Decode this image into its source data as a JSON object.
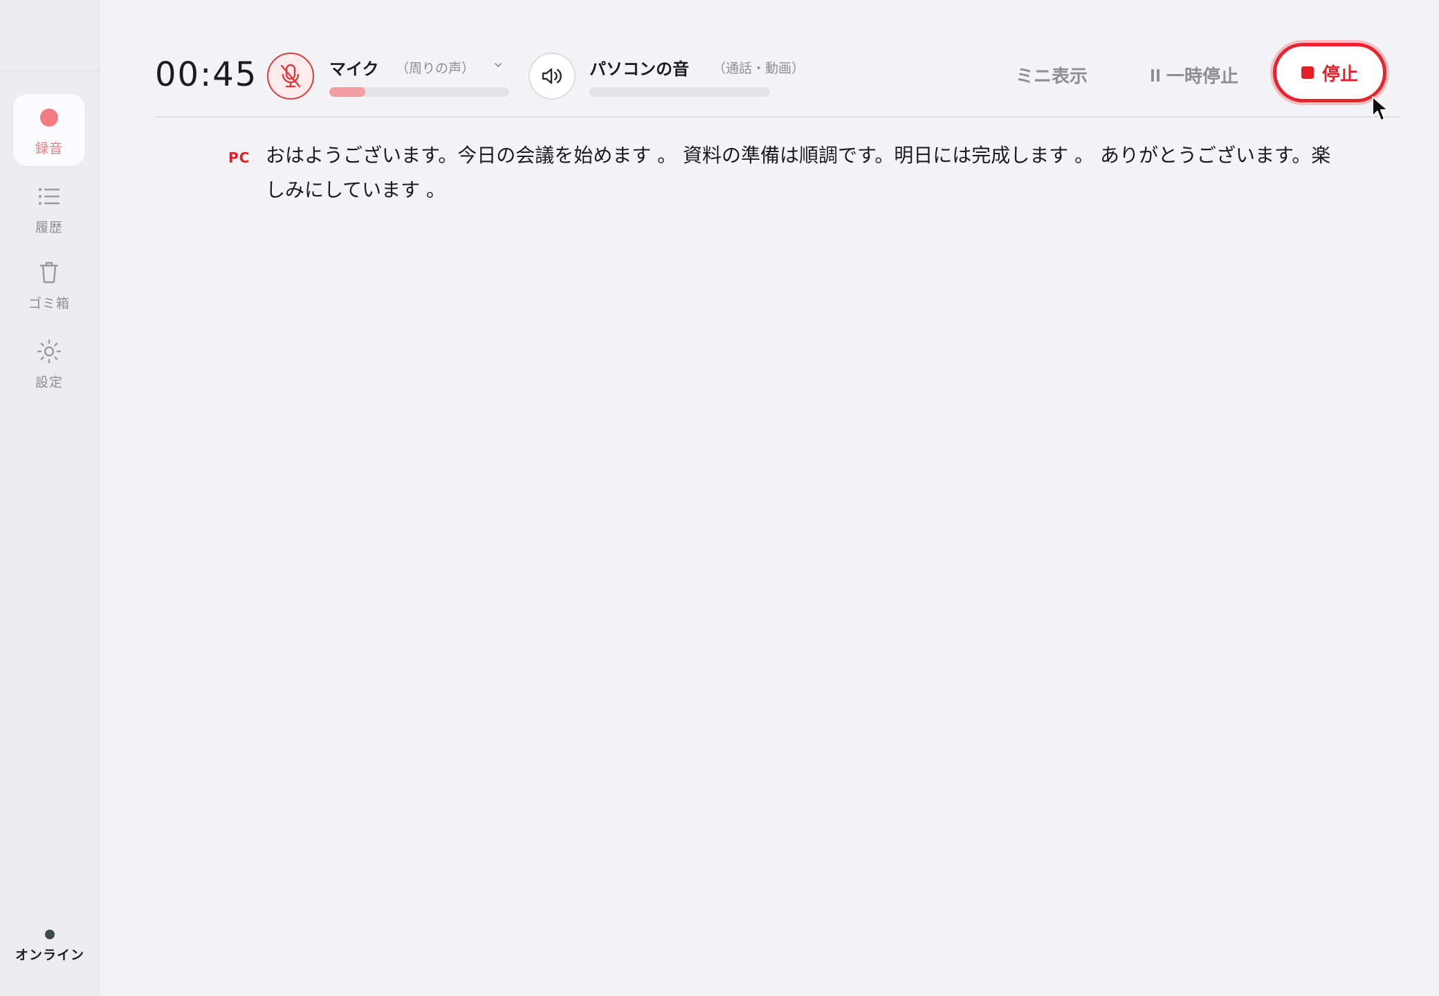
{
  "sidebar": {
    "items": [
      {
        "label": "録音",
        "icon": "record-dot-icon",
        "active": true
      },
      {
        "label": "履歴",
        "icon": "list-icon",
        "active": false
      },
      {
        "label": "ゴミ箱",
        "icon": "trash-icon",
        "active": false
      },
      {
        "label": "設定",
        "icon": "sun-gear-icon",
        "active": false
      }
    ],
    "status": {
      "label": "オンライン",
      "color": "#3c4b44"
    }
  },
  "topbar": {
    "timer": "00:45",
    "mic": {
      "title": "マイク",
      "subtitle": "（周りの声）",
      "level": 0.2,
      "muted": true
    },
    "pc_audio": {
      "title": "パソコンの音",
      "subtitle": "（通話・動画）",
      "level": 0.0
    },
    "mini_label": "ミニ表示",
    "pause_label": "一時停止",
    "stop_label": "停止"
  },
  "transcript": {
    "speaker": "PC",
    "text": "おはようございます。今日の会議を始めます 。 資料の準備は順調です。明日には完成します 。 ありがとうございます。楽しみにしています 。"
  },
  "colors": {
    "accent": "#e3202a",
    "accent_light": "#f27c80",
    "background": "#f4f3f6",
    "sidebar": "#ededf0"
  }
}
